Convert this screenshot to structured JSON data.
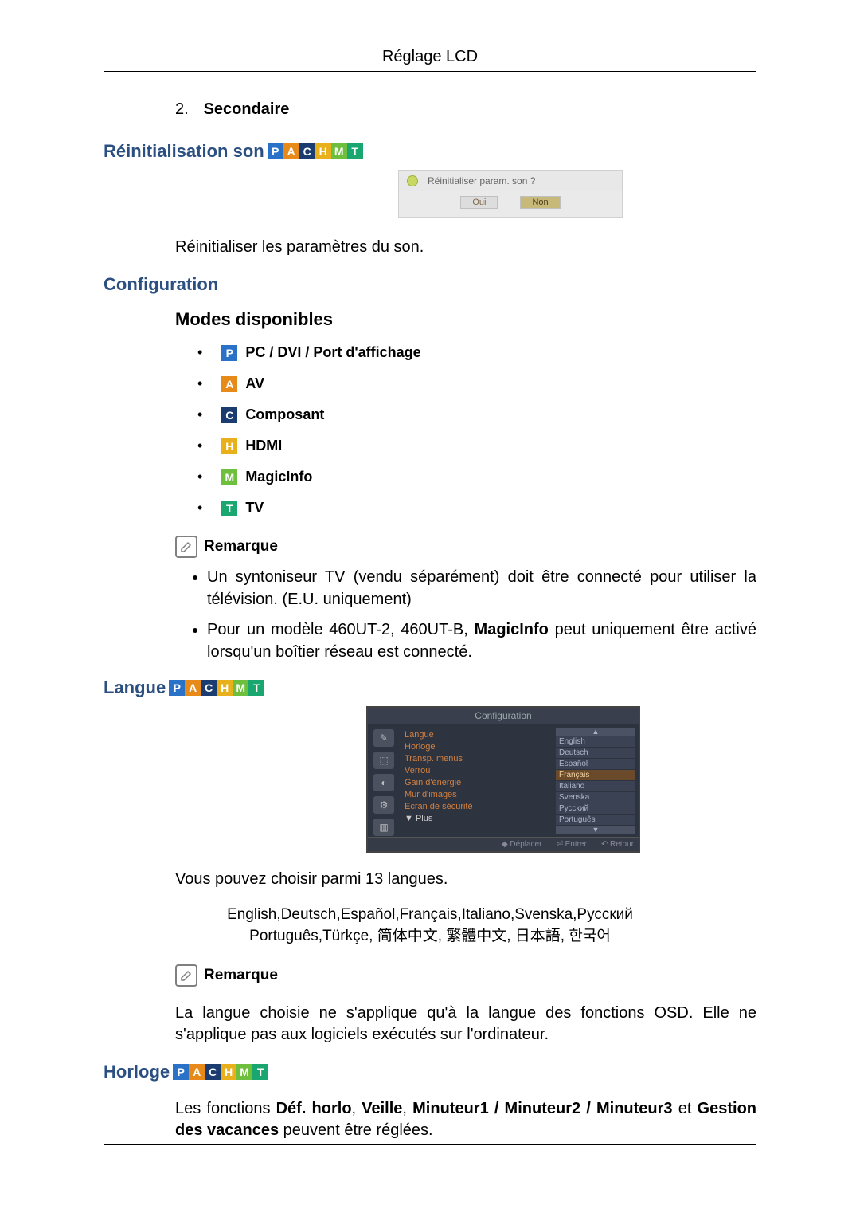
{
  "header": {
    "title": "Réglage LCD"
  },
  "secondary": {
    "num": "2.",
    "label": "Secondaire"
  },
  "reinit": {
    "heading": "Réinitialisation son",
    "badges": [
      "P",
      "A",
      "C",
      "H",
      "M",
      "T"
    ],
    "popup": {
      "question": "Réinitialiser param. son ?",
      "yes": "Oui",
      "no": "Non"
    },
    "description": "Réinitialiser les paramètres du son."
  },
  "config": {
    "heading": "Configuration",
    "modes_heading": "Modes disponibles",
    "modes": [
      {
        "badge": "P",
        "label": "PC / DVI / Port d'affichage"
      },
      {
        "badge": "A",
        "label": "AV"
      },
      {
        "badge": "C",
        "label": "Composant"
      },
      {
        "badge": "H",
        "label": "HDMI"
      },
      {
        "badge": "M",
        "label": "MagicInfo"
      },
      {
        "badge": "T",
        "label": "TV"
      }
    ],
    "remark_label": "Remarque",
    "remarks": [
      {
        "pre": "Un syntoniseur TV (vendu séparément) doit être connecté pour utiliser la télévision. (E.U. uniquement)"
      },
      {
        "pre": "Pour un modèle 460UT-2, 460UT-B, ",
        "bold": "MagicInfo",
        "post": " peut uniquement être activé lorsqu'un boîtier réseau est connecté."
      }
    ]
  },
  "langue": {
    "heading": "Langue",
    "badges": [
      "P",
      "A",
      "C",
      "H",
      "M",
      "T"
    ],
    "osd": {
      "title": "Configuration",
      "menu": [
        "Langue",
        "Horloge",
        "Transp. menus",
        "Verrou",
        "Gain d'énergie",
        "Mur d'images",
        "Ecran de sécurité"
      ],
      "more": "▼ Plus",
      "options": [
        "English",
        "Deutsch",
        "Español",
        "Français",
        "Italiano",
        "Svenska",
        "Русский",
        "Português"
      ],
      "selected": "Français",
      "footer": {
        "move": "◆ Déplacer",
        "enter": "⏎ Entrer",
        "back": "↶ Retour"
      }
    },
    "description": "Vous pouvez choisir parmi 13 langues.",
    "lang_list_line1": "English,Deutsch,Español,Français,Italiano,Svenska,Русский",
    "lang_list_line2": "Português,Türkçe, 简体中文, 繁體中文, 日本語, 한국어",
    "remark_label": "Remarque",
    "remark_text": "La langue choisie ne s'applique qu'à la langue des fonctions OSD. Elle ne s'applique pas aux logiciels exécutés sur l'ordinateur."
  },
  "horloge": {
    "heading": "Horloge",
    "badges": [
      "P",
      "A",
      "C",
      "H",
      "M",
      "T"
    ],
    "desc_pre": "Les fonctions ",
    "b1": "Déf. horlo",
    "sep1": ", ",
    "b2": "Veille",
    "sep2": ", ",
    "b3": "Minuteur1 / Minuteur2 / Minuteur3",
    "sep3": " et ",
    "b4": "Gestion des vacances",
    "desc_post": " peuvent être réglées."
  }
}
